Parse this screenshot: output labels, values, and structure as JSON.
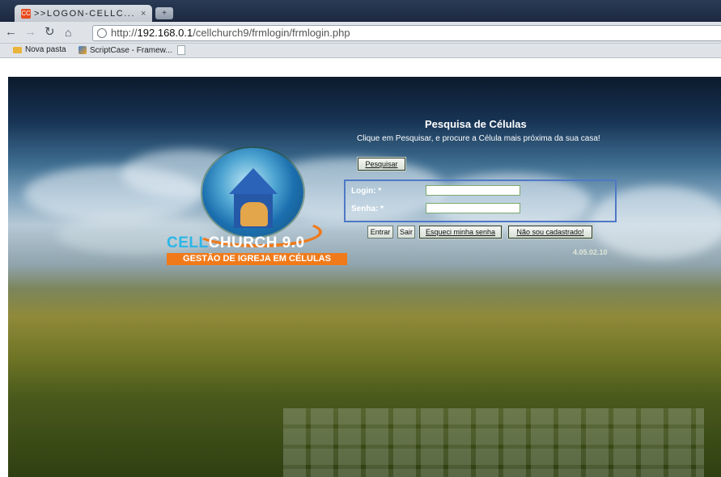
{
  "browser": {
    "tab_title": ">>LOGON-CELLC...",
    "tab_close": "×",
    "tab_favicon": "CC",
    "address_scheme": "http://",
    "address_host": "192.168.0.1",
    "address_path": "/cellchurch9/frmlogin/frmlogin.php",
    "bookmarks": [
      {
        "label": "Nova pasta",
        "icon": "folder-icon"
      },
      {
        "label": "ScriptCase - Framew...",
        "icon": "scriptcase-icon"
      }
    ]
  },
  "brand": {
    "name_part1": "CELL",
    "name_part2": "CHURCH 9.0",
    "tagline": "GESTÃO DE IGREJA EM CÉLULAS",
    "colors": {
      "accent": "#2bb6e8",
      "orange": "#f07a1a"
    }
  },
  "search": {
    "title": "Pesquisa de Células",
    "description": "Clique em Pesquisar, e procure a Célula mais próxima da sua casa!",
    "button": "Pesquisar"
  },
  "login": {
    "login_label": "Login: *",
    "login_value": "",
    "password_label": "Senha: *",
    "password_value": "",
    "submit": "Entrar",
    "exit": "Sair",
    "forgot": "Esqueci minha senha",
    "register": "Não sou cadastrado!",
    "border_color": "#4f78c6"
  },
  "version": "4.05.02.10"
}
